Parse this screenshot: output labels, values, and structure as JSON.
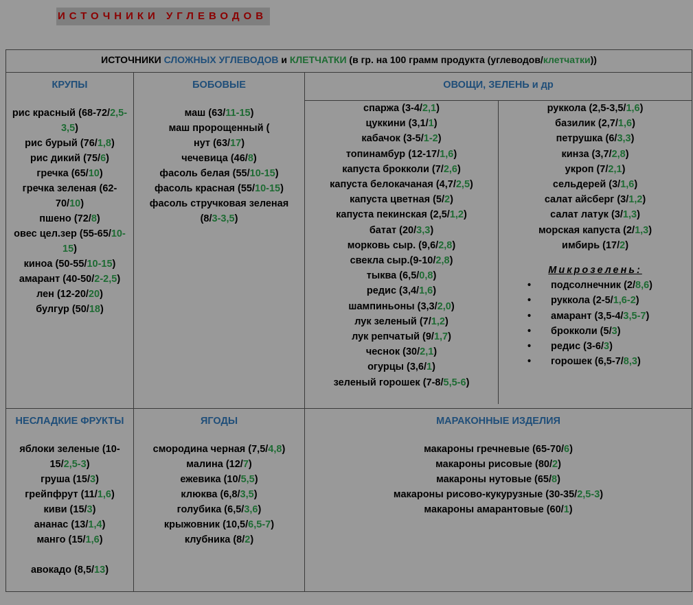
{
  "page_title": "ИСТОЧНИКИ УГЛЕВОДОВ",
  "header": {
    "part1": "ИСТОЧНИКИ ",
    "complex": "СЛОЖНЫХ УГЛЕВОДОВ",
    "part2": " и ",
    "fiber": "КЛЕТЧАТКИ",
    "part3": " (в гр. на 100 грамм продукта (углеводов/",
    "fiber2": "клетчатки",
    "part4": "))"
  },
  "colors": {
    "title_red": "#8b0000",
    "heading_blue": "#1f4e79",
    "fiber_green": "#1e6b33",
    "background": "#999999"
  },
  "grains": {
    "title": "КРУПЫ",
    "items": [
      {
        "a": "рис красный (68-72/",
        "g": "2,5-3,5",
        "b": ")"
      },
      {
        "a": "рис бурый (76/",
        "g": "1,8",
        "b": ")"
      },
      {
        "a": "рис дикий (75/",
        "g": "6",
        "b": ")"
      },
      {
        "a": "гречка (65/",
        "g": "10",
        "b": ")"
      },
      {
        "a": "гречка зеленая (62-70/",
        "g": "10",
        "b": ")"
      },
      {
        "a": "пшено (72/",
        "g": "8",
        "b": ")"
      },
      {
        "a": "овес цел.зер (55-65/",
        "g": "10-15",
        "b": ")"
      },
      {
        "a": "киноа (50-55/",
        "g": "10-15",
        "b": ")"
      },
      {
        "a": "амарант (40-50/",
        "g": "2-2,5",
        "b": ")"
      },
      {
        "a": "лен (12-20/",
        "g": "20",
        "b": ")"
      },
      {
        "a": "булгур (50/",
        "g": "18",
        "b": ")"
      }
    ]
  },
  "legumes": {
    "title": "БОБОВЫЕ",
    "items": [
      {
        "a": "маш (63/",
        "g": "11-15",
        "b": ")"
      },
      {
        "a": "маш пророщенный (",
        "g": "",
        "b": ""
      },
      {
        "a": "нут (63/",
        "g": "17",
        "b": ")"
      },
      {
        "a": "чечевица (46/",
        "g": "8",
        "b": ")"
      },
      {
        "a": "фасоль белая (55/",
        "g": "10-15",
        "b": ")"
      },
      {
        "a": "фасоль красная (55/",
        "g": "10-15",
        "b": ")"
      },
      {
        "a": "фасоль стручковая зеленая (8/",
        "g": "3-3,5",
        "b": ")"
      }
    ]
  },
  "veg": {
    "title": "ОВОЩИ, ЗЕЛЕНЬ и др",
    "left": [
      {
        "a": "спаржа (3-4/",
        "g": "2,1",
        "b": ")"
      },
      {
        "a": "цуккини (3,1/",
        "g": "1",
        "b": ")"
      },
      {
        "a": "кабачок (3-5/",
        "g": "1-2",
        "b": ")"
      },
      {
        "a": "топинамбур (12-17/",
        "g": "1,6",
        "b": ")"
      },
      {
        "a": "капуста брокколи (7/",
        "g": "2,6",
        "b": ")"
      },
      {
        "a": "капуста белокачаная (4,7/",
        "g": "2,5",
        "b": ")"
      },
      {
        "a": "капуста цветная (5/",
        "g": "2",
        "b": ")"
      },
      {
        "a": "капуста пекинская (2,5/",
        "g": "1,2",
        "b": ")"
      },
      {
        "a": "батат (20/",
        "g": "3,3",
        "b": ")"
      },
      {
        "a": "морковь сыр. (9,6/",
        "g": "2,8",
        "b": ")"
      },
      {
        "a": "свекла сыр.(9-10/",
        "g": "2,8",
        "b": ")"
      },
      {
        "a": "тыква (6,5/",
        "g": "0,8",
        "b": ")"
      },
      {
        "a": "редис (3,4/",
        "g": "1,6",
        "b": ")"
      },
      {
        "a": "шампиньоны (3,3/",
        "g": "2,0",
        "b": ")"
      },
      {
        "a": "лук зеленый  (7/",
        "g": "1,2",
        "b": ")"
      },
      {
        "a": "лук репчатый (9/",
        "g": "1,7",
        "b": ")"
      },
      {
        "a": "чеснок (30/",
        "g": "2,1",
        "b": ")"
      },
      {
        "a": "огурцы (3,6/",
        "g": "1",
        "b": ")"
      },
      {
        "a": "зеленый горошек (7-8/",
        "g": "5,5-6",
        "b": ")"
      }
    ],
    "right": [
      {
        "a": "руккола (2,5-3,5/",
        "g": "1,6",
        "b": ")"
      },
      {
        "a": "базилик (2,7/",
        "g": "1,6",
        "b": ")"
      },
      {
        "a": "петрушка (6/",
        "g": "3,3",
        "b": ")"
      },
      {
        "a": "кинза (3,7/",
        "g": "2,8",
        "b": ")"
      },
      {
        "a": "укроп (7/",
        "g": "2,1",
        "b": ")"
      },
      {
        "a": "сельдерей (3/",
        "g": "1,6",
        "b": ")"
      },
      {
        "a": "салат айсберг (3/",
        "g": "1,2",
        "b": ")"
      },
      {
        "a": "салат латук (3/",
        "g": "1,3",
        "b": ")"
      },
      {
        "a": "морская капуста (2/",
        "g": "1,3",
        "b": ")"
      },
      {
        "a": "имбирь (17/",
        "g": "2",
        "b": ")"
      }
    ],
    "micro_title": "Микрозелень:",
    "micro": [
      {
        "a": "подсолнечник (2/",
        "g": "8,6",
        "b": ")"
      },
      {
        "a": "руккола (2-5/",
        "g": "1,6-2",
        "b": ")"
      },
      {
        "a": "амарант (3,5-4/",
        "g": "3,5-7",
        "b": ")"
      },
      {
        "a": "брокколи (5/",
        "g": "3",
        "b": ")"
      },
      {
        "a": "редис (3-6/",
        "g": "3",
        "b": ")"
      },
      {
        "a": "горошек (6,5-7/",
        "g": "8,3",
        "b": ")"
      }
    ]
  },
  "fruits": {
    "title": "НЕСЛАДКИЕ ФРУКТЫ",
    "items": [
      {
        "a": "яблоки зеленые (10-15/",
        "g": "2,5-3",
        "b": ")"
      },
      {
        "a": "груша (15/",
        "g": "3",
        "b": ")"
      },
      {
        "a": "грейпфрут (11/",
        "g": "1,6",
        "b": ")"
      },
      {
        "a": "киви (15/",
        "g": "3",
        "b": ")"
      },
      {
        "a": "ананас (13/",
        "g": "1,4",
        "b": ")"
      },
      {
        "a": "манго (15/",
        "g": "1,6",
        "b": ")"
      }
    ],
    "extra": {
      "a": "авокадо (8,5/",
      "g": "13",
      "b": ")"
    }
  },
  "berries": {
    "title": "ЯГОДЫ",
    "items": [
      {
        "a": "смородина черная (7,5/",
        "g": "4,8",
        "b": ")"
      },
      {
        "a": "малина (12/",
        "g": "7",
        "b": ")"
      },
      {
        "a": "ежевика (10/",
        "g": "5,5",
        "b": ")"
      },
      {
        "a": "клюква (6,8/",
        "g": "3,5",
        "b": ")"
      },
      {
        "a": "голубика (6,5/",
        "g": "3,6",
        "b": ")"
      },
      {
        "a": "крыжовник (10,5/",
        "g": "6,5-7",
        "b": ")"
      },
      {
        "a": "клубника (8/",
        "g": "2",
        "b": ")"
      }
    ]
  },
  "pasta": {
    "title": "МАРАКОННЫЕ ИЗДЕЛИЯ",
    "items": [
      {
        "a": "макароны гречневые (65-70/",
        "g": "6",
        "b": ")"
      },
      {
        "a": "макароны рисовые (80/",
        "g": "2",
        "b": ")"
      },
      {
        "a": "макароны нутовые (65/",
        "g": "8",
        "b": ")"
      },
      {
        "a": "макароны рисово-кукурузные (30-35/",
        "g": "2,5-3",
        "b": ")"
      },
      {
        "a": "макароны амарантовые (60/",
        "g": "1",
        "b": ")"
      }
    ]
  }
}
